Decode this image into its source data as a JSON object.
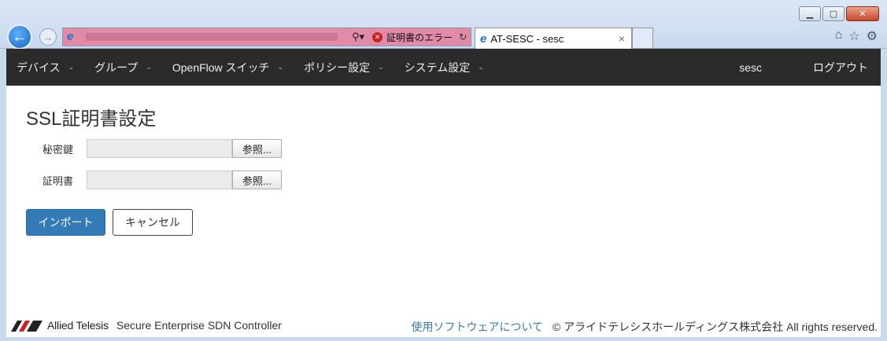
{
  "browser": {
    "address_error": "証明書のエラー",
    "tab_title": "AT-SESC - sesc",
    "search_glyph": "⚲▾",
    "refresh_glyph": "↻",
    "close_glyph": "×"
  },
  "nav": {
    "items": [
      {
        "label": "デバイス"
      },
      {
        "label": "グループ"
      },
      {
        "label": "OpenFlow スイッチ"
      },
      {
        "label": "ポリシー設定"
      },
      {
        "label": "システム設定"
      }
    ],
    "caret": "⌄",
    "user": "sesc",
    "logout": "ログアウト"
  },
  "page": {
    "title": "SSL証明書設定",
    "private_key_label": "秘密鍵",
    "certificate_label": "証明書",
    "browse_label": "参照...",
    "import_button": "インポート",
    "cancel_button": "キャンセル"
  },
  "footer": {
    "logo_text": "Allied Telesis",
    "product": "Secure Enterprise SDN Controller",
    "license_link": "使用ソフトウェアについて",
    "copyright": "© アライドテレシスホールディングス株式会社 All rights reserved."
  },
  "colors": {
    "navbar": "#2b2b2b",
    "primary": "#337ab7",
    "address_error_bg": "#e18ba6"
  }
}
